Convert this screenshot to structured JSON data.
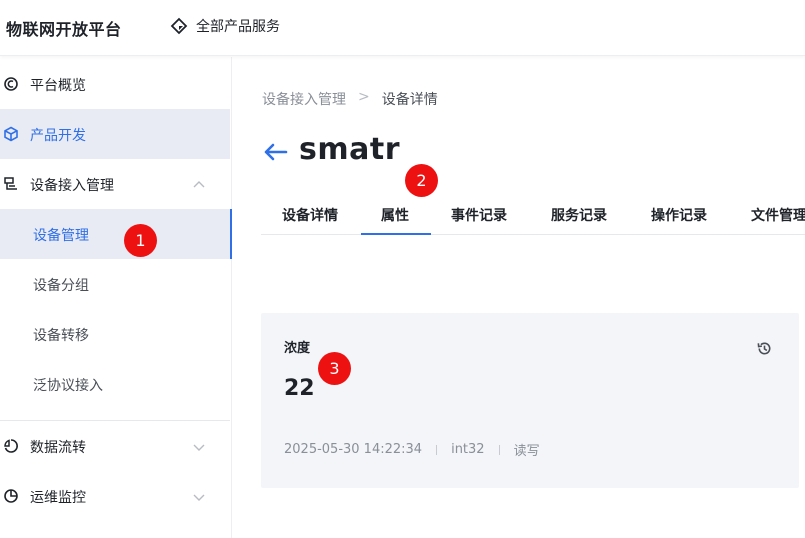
{
  "header": {
    "brand": "物联网开放平台",
    "products_label": "全部产品服务"
  },
  "sidebar": {
    "items": [
      {
        "label": "平台概览",
        "icon": "overview-icon"
      },
      {
        "label": "产品开发",
        "icon": "cube-icon"
      },
      {
        "label": "设备接入管理",
        "icon": "device-access-icon"
      },
      {
        "label": "数据流转",
        "icon": "data-flow-icon"
      },
      {
        "label": "运维监控",
        "icon": "monitor-pie-icon"
      }
    ],
    "sub_items": [
      {
        "label": "设备管理"
      },
      {
        "label": "设备分组"
      },
      {
        "label": "设备转移"
      },
      {
        "label": "泛协议接入"
      }
    ]
  },
  "breadcrumb": {
    "parent": "设备接入管理",
    "separator": ">",
    "current": "设备详情"
  },
  "device": {
    "name": "smatr"
  },
  "tabs": [
    {
      "label": "设备详情"
    },
    {
      "label": "属性"
    },
    {
      "label": "事件记录"
    },
    {
      "label": "服务记录"
    },
    {
      "label": "操作记录"
    },
    {
      "label": "文件管理"
    }
  ],
  "property_card": {
    "name": "浓度",
    "value": "22",
    "timestamp": "2025-05-30 14:22:34",
    "data_type": "int32",
    "access": "读写"
  },
  "annotations": {
    "badge_1": "1",
    "badge_2": "2",
    "badge_3": "3"
  },
  "colors": {
    "accent": "#2f6fe8",
    "badge": "#ee1111",
    "card_bg": "#f3f5f8",
    "selected_bg": "#e8ebf3"
  }
}
